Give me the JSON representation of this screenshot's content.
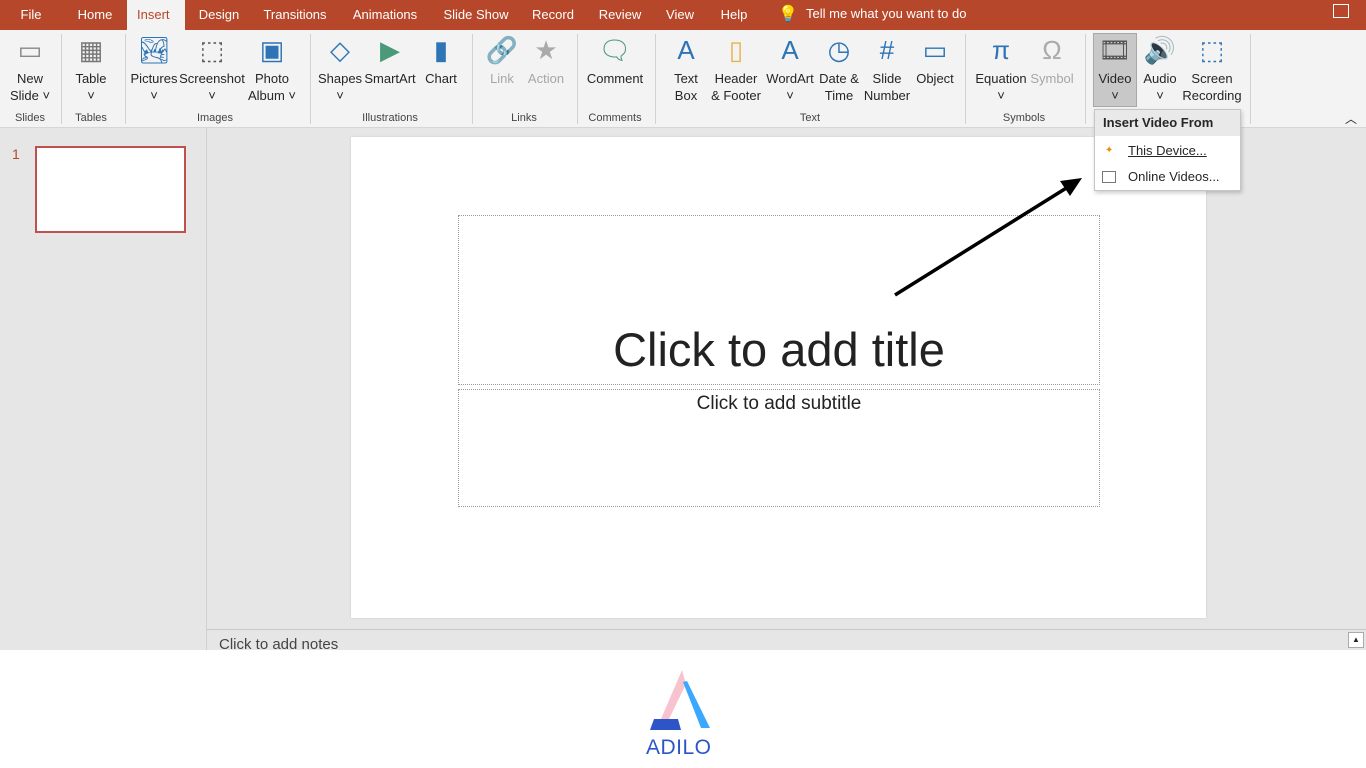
{
  "tabs": [
    {
      "label": "File"
    },
    {
      "label": "Home"
    },
    {
      "label": "Insert",
      "active": true
    },
    {
      "label": "Design"
    },
    {
      "label": "Transitions"
    },
    {
      "label": "Animations"
    },
    {
      "label": "Slide Show"
    },
    {
      "label": "Record"
    },
    {
      "label": "Review"
    },
    {
      "label": "View"
    },
    {
      "label": "Help"
    }
  ],
  "tell_me": "Tell me what you want to do",
  "ribbon": {
    "buttons": [
      {
        "id": "new-slide",
        "l1": "New",
        "l2": "Slide ˅",
        "icon": "new-slide-icon",
        "glyph": "▭",
        "color": "#888"
      },
      {
        "id": "table",
        "l1": "Table",
        "l2": "˅",
        "icon": "table-icon",
        "glyph": "▦",
        "color": "#777"
      },
      {
        "id": "pictures",
        "l1": "Pictures",
        "l2": "˅",
        "icon": "pictures-icon",
        "glyph": "🏞",
        "color": "#2e75b6"
      },
      {
        "id": "screenshot",
        "l1": "Screenshot",
        "l2": "˅",
        "icon": "screenshot-icon",
        "glyph": "⬚",
        "color": "#555"
      },
      {
        "id": "photo-album",
        "l1": "Photo",
        "l2": "Album ˅",
        "icon": "photo-album-icon",
        "glyph": "▣",
        "color": "#2e75b6"
      },
      {
        "id": "shapes",
        "l1": "Shapes",
        "l2": "˅",
        "icon": "shapes-icon",
        "glyph": "◇",
        "color": "#2e75b6"
      },
      {
        "id": "smartart",
        "l1": "SmartArt",
        "l2": "",
        "icon": "smartart-icon",
        "glyph": "▶",
        "color": "#4a9a7a"
      },
      {
        "id": "chart",
        "l1": "Chart",
        "l2": "",
        "icon": "chart-icon",
        "glyph": "▮",
        "color": "#2e75b6"
      },
      {
        "id": "link",
        "l1": "Link",
        "l2": "",
        "icon": "link-icon",
        "glyph": "🔗",
        "color": "#aaa",
        "disabled": true
      },
      {
        "id": "action",
        "l1": "Action",
        "l2": "",
        "icon": "action-icon",
        "glyph": "★",
        "color": "#aaa",
        "disabled": true
      },
      {
        "id": "comment",
        "l1": "Comment",
        "l2": "",
        "icon": "comment-icon",
        "glyph": "🗨",
        "color": "#4a9a7a"
      },
      {
        "id": "text-box",
        "l1": "Text",
        "l2": "Box",
        "icon": "text-box-icon",
        "glyph": "A",
        "color": "#2e75b6"
      },
      {
        "id": "header-footer",
        "l1": "Header",
        "l2": "& Footer",
        "icon": "header-footer-icon",
        "glyph": "▯",
        "color": "#e8b54a"
      },
      {
        "id": "wordart",
        "l1": "WordArt",
        "l2": "˅",
        "icon": "wordart-icon",
        "glyph": "A",
        "color": "#2e75b6"
      },
      {
        "id": "date-time",
        "l1": "Date &",
        "l2": "Time",
        "icon": "date-time-icon",
        "glyph": "◷",
        "color": "#2e75b6"
      },
      {
        "id": "slide-number",
        "l1": "Slide",
        "l2": "Number",
        "icon": "slide-number-icon",
        "glyph": "#",
        "color": "#2e75b6"
      },
      {
        "id": "object",
        "l1": "Object",
        "l2": "",
        "icon": "object-icon",
        "glyph": "▭",
        "color": "#2e75b6"
      },
      {
        "id": "equation",
        "l1": "Equation",
        "l2": "˅",
        "icon": "pi-icon",
        "glyph": "π",
        "color": "#2e75b6"
      },
      {
        "id": "symbol",
        "l1": "Symbol",
        "l2": "",
        "icon": "omega-icon",
        "glyph": "Ω",
        "color": "#aaa",
        "disabled": true
      },
      {
        "id": "video",
        "l1": "Video",
        "l2": "˅",
        "icon": "video-icon",
        "glyph": "🎞",
        "color": "#555",
        "selected": true
      },
      {
        "id": "audio",
        "l1": "Audio",
        "l2": "˅",
        "icon": "audio-icon",
        "glyph": "🔊",
        "color": "#666"
      },
      {
        "id": "screen-recording",
        "l1": "Screen",
        "l2": "Recording",
        "icon": "screen-recording-icon",
        "glyph": "⬚",
        "color": "#2e75b6"
      }
    ],
    "groups": [
      "Slides",
      "Tables",
      "Images",
      "Illustrations",
      "Links",
      "Comments",
      "Text",
      "Symbols"
    ]
  },
  "thumbnail_number": "1",
  "slide": {
    "title_placeholder": "Click to add title",
    "subtitle_placeholder": "Click to add subtitle"
  },
  "notes_placeholder": "Click to add notes",
  "video_menu": {
    "header": "Insert Video From",
    "items": [
      "This Device...",
      "Online Videos..."
    ]
  },
  "logo": {
    "text": "ADILO",
    "colors": [
      "#f7c3ce",
      "#3aa8ff",
      "#2e55c8"
    ]
  },
  "colors": {
    "accent": "#b7472a"
  }
}
